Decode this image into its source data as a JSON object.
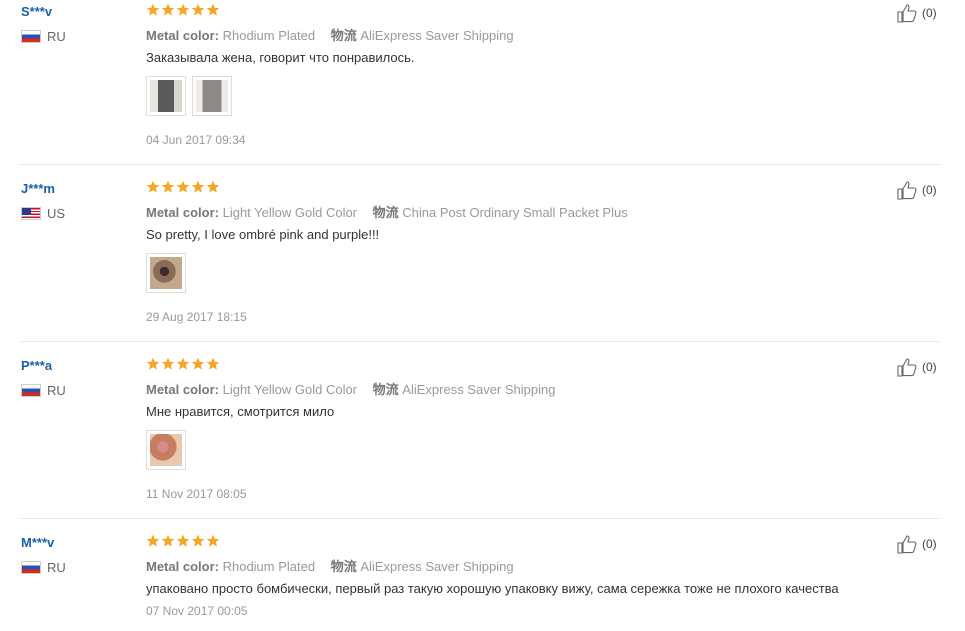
{
  "labels": {
    "metal_color": "Metal color:",
    "shipping": "物流"
  },
  "reviews": [
    {
      "user": "S***v",
      "country": "RU",
      "flag": "ru",
      "metal_color": "Rhodium Plated",
      "shipping": "AliExpress Saver Shipping",
      "text": "Заказывала жена, говорит что понравилось.",
      "date": "04 Jun 2017 09:34",
      "likes": "(0)",
      "photos": 2
    },
    {
      "user": "J***m",
      "country": "US",
      "flag": "us",
      "metal_color": "Light Yellow Gold Color",
      "shipping": "China Post Ordinary Small Packet Plus",
      "text": "So pretty, I love ombré pink and purple!!!",
      "date": "29 Aug 2017 18:15",
      "likes": "(0)",
      "photos": 1
    },
    {
      "user": "P***a",
      "country": "RU",
      "flag": "ru",
      "metal_color": "Light Yellow Gold Color",
      "shipping": "AliExpress Saver Shipping",
      "text": "Мне нравится, смотрится мило",
      "date": "11 Nov 2017 08:05",
      "likes": "(0)",
      "photos": 1
    },
    {
      "user": "M***v",
      "country": "RU",
      "flag": "ru",
      "metal_color": "Rhodium Plated",
      "shipping": "AliExpress Saver Shipping",
      "text": "упаковано просто бомбически, первый раз такую хорошую упаковку вижу, сама сережка тоже не плохого качества",
      "date": "07 Nov 2017 00:05",
      "likes": "(0)",
      "photos": 0
    }
  ],
  "colors": {
    "star": "#f5a623",
    "user": "#1a5fa8"
  }
}
